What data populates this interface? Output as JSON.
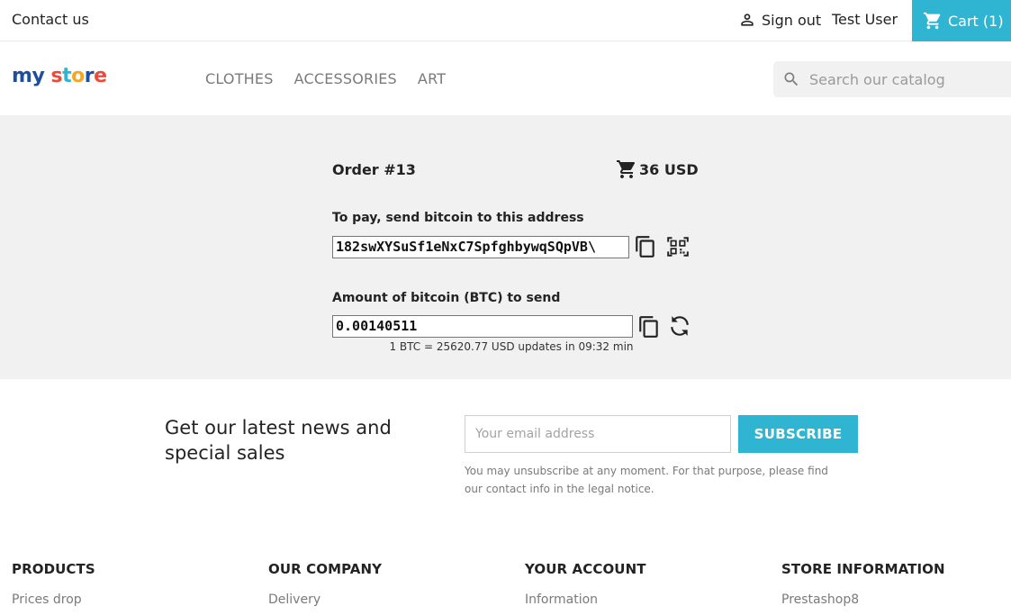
{
  "topbar": {
    "contact": "Contact us",
    "sign_out": "Sign out",
    "user": "Test User",
    "cart": "Cart (1)"
  },
  "header": {
    "logo_text": "my store",
    "nav": [
      "CLOTHES",
      "ACCESSORIES",
      "ART"
    ],
    "search_placeholder": "Search our catalog"
  },
  "payment": {
    "order": "Order #13",
    "total": "36 USD",
    "address_label": "To pay, send bitcoin to this address",
    "address_value": "182swXYSuSf1eNxC7SpfghbywqSQpVB\\",
    "amount_label": "Amount of bitcoin (BTC) to send",
    "amount_value": "0.00140511",
    "rate_text": "1 BTC = 25620.77 USD updates in 09:32 min"
  },
  "newsletter": {
    "title": "Get our latest news and special sales",
    "email_placeholder": "Your email address",
    "subscribe": "SUBSCRIBE",
    "note": "You may unsubscribe at any moment. For that purpose, please find our contact info in the legal notice."
  },
  "footer": {
    "columns": [
      {
        "title": "PRODUCTS",
        "link": "Prices drop"
      },
      {
        "title": "OUR COMPANY",
        "link": "Delivery"
      },
      {
        "title": "YOUR ACCOUNT",
        "link": "Information"
      },
      {
        "title": "STORE INFORMATION",
        "link": "Prestashop8"
      }
    ]
  },
  "colors": {
    "accent": "#2fb5d2",
    "panel_bg": "#f1f1f1"
  },
  "icons": [
    "person-icon",
    "cart-icon",
    "search-icon",
    "copy-icon",
    "qr-code-icon",
    "refresh-icon"
  ]
}
